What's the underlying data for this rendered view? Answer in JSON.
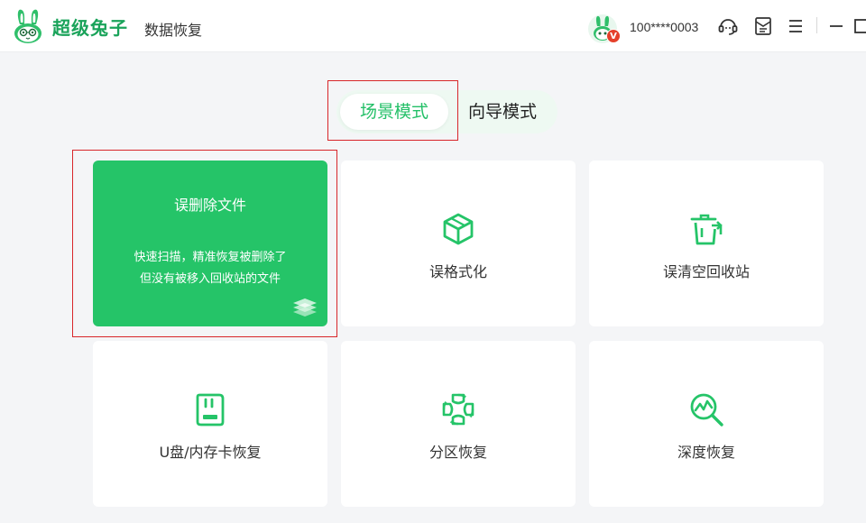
{
  "app": {
    "brand_name": "超级兔子",
    "product_name": "数据恢复"
  },
  "user": {
    "username": "100****0003",
    "vip_badge": "V"
  },
  "toolbar": {
    "icons": [
      "customer-service-icon",
      "message-icon",
      "menu-icon",
      "minimize-icon",
      "maximize-icon"
    ]
  },
  "modes": {
    "active": "场景模式",
    "inactive": "向导模式"
  },
  "cards": {
    "accidental_delete": {
      "title": "误删除文件",
      "desc_line1": "快速扫描，精准恢复被删除了",
      "desc_line2": "但没有被移入回收站的文件"
    },
    "format": {
      "label": "误格式化"
    },
    "recycle_bin": {
      "label": "误清空回收站"
    },
    "usb_card": {
      "label": "U盘/内存卡恢复"
    },
    "partition": {
      "label": "分区恢复"
    },
    "deep": {
      "label": "深度恢复"
    }
  },
  "colors": {
    "accent": "#25c468",
    "brand": "#1aa35a",
    "highlight_outline": "#d8262a",
    "background": "#f4f5f7"
  }
}
